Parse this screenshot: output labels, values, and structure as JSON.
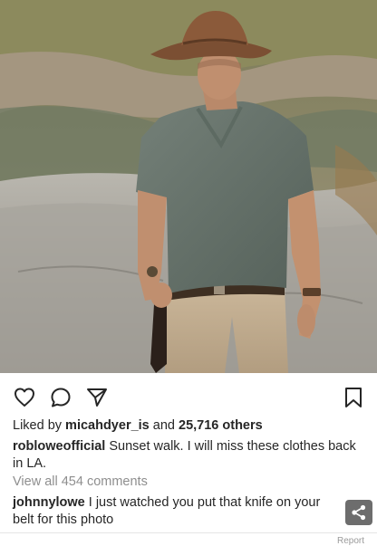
{
  "post": {
    "likes": {
      "prefix": "Liked by",
      "user": "micahdyer_is",
      "middle": "and",
      "count": "25,716 others"
    },
    "caption": {
      "username": "robloweofficial",
      "text": "Sunset walk. I will miss these clothes back in LA."
    },
    "view_comments": "View all 454 comments",
    "comment": {
      "username": "johnnylowe",
      "text": "I just watched you put that knife on your belt for this photo"
    },
    "report": "Report"
  },
  "icons": {
    "like": "heart-icon",
    "comment": "comment-icon",
    "share": "send-icon",
    "save": "bookmark-icon",
    "share_fab": "share-icon"
  },
  "colors": {
    "text": "#262626",
    "muted": "#8e8e8e",
    "fab": "#6d6d6d"
  }
}
